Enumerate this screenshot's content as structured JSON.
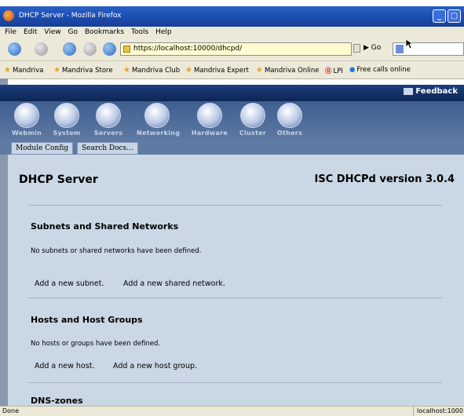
{
  "window": {
    "title": "DHCP Server - Mozilla Firefox",
    "minimize_icon": "minimize-icon",
    "maximize_icon": "maximize-icon"
  },
  "menu": [
    "File",
    "Edit",
    "View",
    "Go",
    "Bookmarks",
    "Tools",
    "Help"
  ],
  "nav": {
    "url": "https://localhost:10000/dhcpd/",
    "go_label": "Go"
  },
  "bookmarks": [
    "Mandriva",
    "Mandriva Store",
    "Mandriva Club",
    "Mandriva Expert",
    "Mandriva Online",
    "LPI",
    "Free calls online"
  ],
  "webmin": {
    "feedback_label": "Feedback",
    "categories": [
      "Webmin",
      "System",
      "Servers",
      "Networking",
      "Hardware",
      "Cluster",
      "Others"
    ],
    "subtabs": [
      "Module Config",
      "Search Docs..."
    ]
  },
  "page": {
    "title": "DHCP Server",
    "version": "ISC DHCPd version 3.0.4",
    "subnets": {
      "heading": "Subnets and Shared Networks",
      "note": "No subnets or shared networks have been defined.",
      "add_subnet": "Add a new subnet.",
      "add_shared": "Add a new shared network."
    },
    "hosts": {
      "heading": "Hosts and Host Groups",
      "note": "No hosts or groups have been defined.",
      "add_host": "Add a new host.",
      "add_group": "Add a new host group."
    },
    "dns": {
      "heading": "DNS-zones"
    }
  },
  "status": {
    "left": "Done",
    "right": "localhost:1000"
  },
  "colors": {
    "titlebar": "#1b4cae",
    "content_bg": "#cad7e4",
    "webmin_header": "#0e2553"
  }
}
